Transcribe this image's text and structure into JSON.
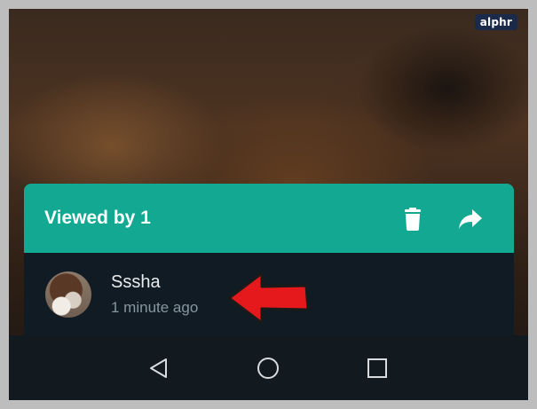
{
  "watermark": {
    "brand": "alphr"
  },
  "status_sheet": {
    "title": "Viewed by 1",
    "accent_color": "#13a891",
    "actions": [
      {
        "icon": "trash-icon",
        "label": "Delete"
      },
      {
        "icon": "share-icon",
        "label": "Forward"
      }
    ],
    "viewers": [
      {
        "name": "Sssha",
        "time": "1 minute ago",
        "avatar_icon": "dog-avatar"
      }
    ]
  },
  "annotation": {
    "icon": "red-arrow-icon",
    "color": "#e5191c"
  },
  "navigation_bar": {
    "buttons": [
      {
        "icon": "back-triangle-icon"
      },
      {
        "icon": "home-circle-icon"
      },
      {
        "icon": "recents-square-icon"
      }
    ]
  }
}
